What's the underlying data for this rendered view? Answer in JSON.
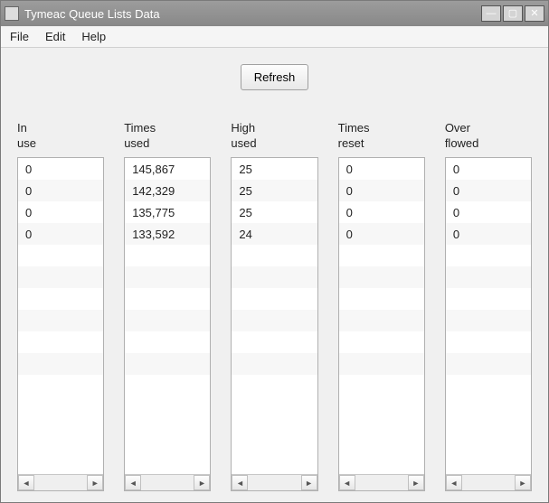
{
  "window": {
    "title": "Tymeac Queue Lists Data"
  },
  "menu": {
    "file": "File",
    "edit": "Edit",
    "help": "Help"
  },
  "buttons": {
    "refresh": "Refresh"
  },
  "columns": [
    {
      "header_line1": "In",
      "header_line2": "use",
      "values": [
        "0",
        "0",
        "0",
        "0"
      ]
    },
    {
      "header_line1": "Times",
      "header_line2": "used",
      "values": [
        "145,867",
        "142,329",
        "135,775",
        "133,592"
      ]
    },
    {
      "header_line1": "High",
      "header_line2": "used",
      "values": [
        "25",
        "25",
        "25",
        "24"
      ]
    },
    {
      "header_line1": "Times",
      "header_line2": "reset",
      "values": [
        "0",
        "0",
        "0",
        "0"
      ]
    },
    {
      "header_line1": "Over",
      "header_line2": "flowed",
      "values": [
        "0",
        "0",
        "0",
        "0"
      ]
    }
  ],
  "glyphs": {
    "minimize": "—",
    "maximize": "▢",
    "close": "✕",
    "left": "◄",
    "right": "►"
  }
}
